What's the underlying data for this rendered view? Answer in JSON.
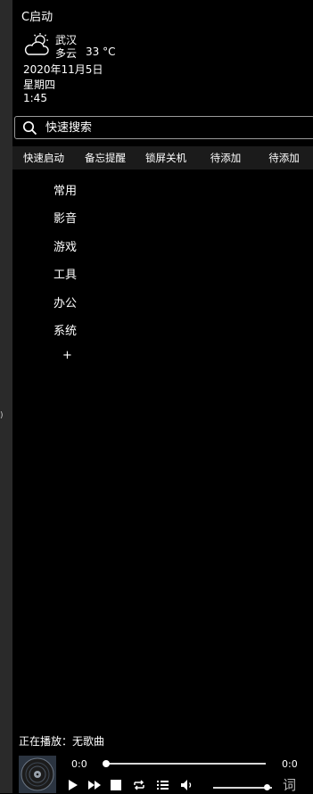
{
  "app": {
    "title": "C启动"
  },
  "weather": {
    "icon": "partly-cloudy-icon",
    "city": "武汉",
    "condition": "多云",
    "temperature": "33 °C",
    "date": "2020年11月5日",
    "weekday": "星期四",
    "time": "1:45"
  },
  "search": {
    "placeholder": "快速搜索"
  },
  "tabs": [
    "快速启动",
    "备忘提醒",
    "锁屏关机",
    "待添加",
    "待添加"
  ],
  "categories": [
    "常用",
    "影音",
    "游戏",
    "工具",
    "办公",
    "系统"
  ],
  "add_category_label": "+",
  "sidebar": {
    "collapse_glyph": ")"
  },
  "player": {
    "now_playing": "正在播放：无歌曲",
    "current_time": "0:0",
    "total_time": "0:0",
    "progress": 0,
    "volume": 0.9,
    "lyrics_label": "词"
  }
}
